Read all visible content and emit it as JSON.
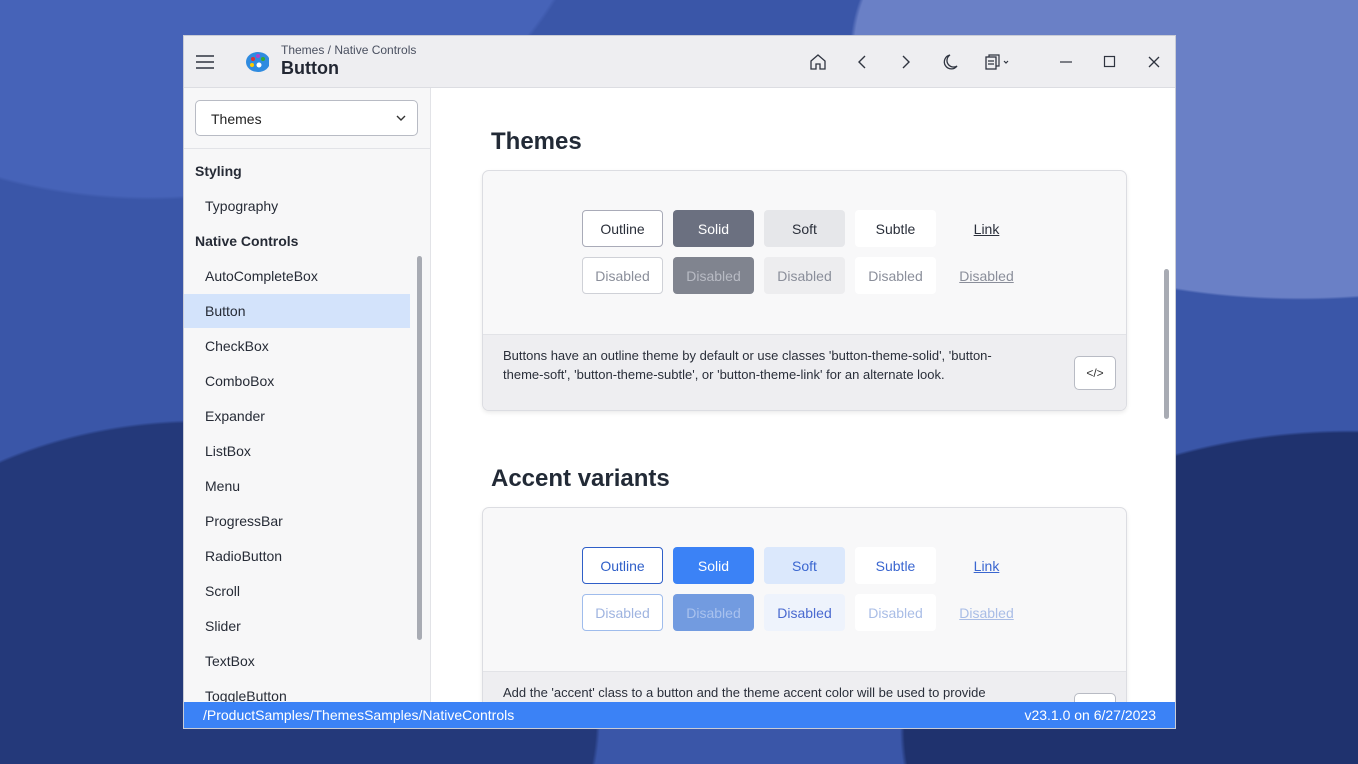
{
  "window": {
    "breadcrumb": "Themes / Native Controls",
    "title": "Button"
  },
  "toolbar": {
    "icons": [
      "home-icon",
      "back-icon",
      "forward-icon",
      "moon-icon",
      "pages-icon",
      "minimize-icon",
      "maximize-icon",
      "close-icon"
    ]
  },
  "sidebar": {
    "selector": "Themes",
    "items": [
      {
        "label": "Styling",
        "type": "header"
      },
      {
        "label": "Typography"
      },
      {
        "label": "Native Controls",
        "type": "header"
      },
      {
        "label": "AutoCompleteBox"
      },
      {
        "label": "Button",
        "selected": true
      },
      {
        "label": "CheckBox"
      },
      {
        "label": "ComboBox"
      },
      {
        "label": "Expander"
      },
      {
        "label": "ListBox"
      },
      {
        "label": "Menu"
      },
      {
        "label": "ProgressBar"
      },
      {
        "label": "RadioButton"
      },
      {
        "label": "Scroll"
      },
      {
        "label": "Slider"
      },
      {
        "label": "TextBox"
      },
      {
        "label": "ToggleButton"
      }
    ]
  },
  "sections": [
    {
      "title": "Themes",
      "buttons": [
        "Outline",
        "Solid",
        "Soft",
        "Subtle",
        "Link"
      ],
      "disabled": [
        "Disabled",
        "Disabled",
        "Disabled",
        "Disabled",
        "Disabled"
      ],
      "description": "Buttons have an outline theme by default or use classes 'button-theme-solid', 'button-theme-soft', 'button-theme-subtle', or 'button-theme-link' for an alternate look.",
      "code": "</>"
    },
    {
      "title": "Accent variants",
      "buttons": [
        "Outline",
        "Solid",
        "Soft",
        "Subtle",
        "Link"
      ],
      "disabled": [
        "Disabled",
        "Disabled",
        "Disabled",
        "Disabled",
        "Disabled"
      ],
      "description": "Add the 'accent' class to a button and the theme accent color will be used to provide",
      "code": "</>"
    }
  ],
  "status": {
    "path": "/ProductSamples/ThemesSamples/NativeControls",
    "version": "v23.1.0 on 6/27/2023"
  },
  "colors": {
    "accent": "#3b82f6",
    "neutral_solid": "#6b7080"
  }
}
